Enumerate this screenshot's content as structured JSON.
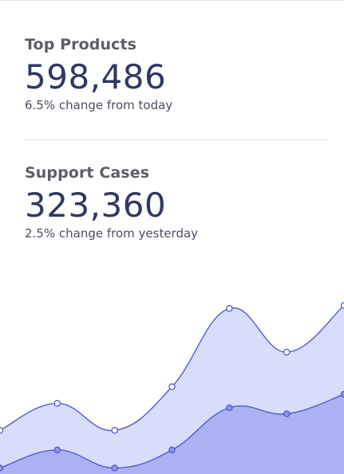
{
  "stats": [
    {
      "label": "Top Products",
      "value": "598,486",
      "change": "6.5% change from today"
    },
    {
      "label": "Support Cases",
      "value": "323,360",
      "change": "2.5% change from yesterday"
    }
  ],
  "colors": {
    "series_back_fill": "#d7ddfa",
    "series_front_fill": "#abb2f3",
    "line": "#4a52d6",
    "marker_fill_back": "#ffffff",
    "marker_fill_front": "#8c95ee",
    "value_text": "#2f3960"
  },
  "chart_data": {
    "type": "area",
    "x": [
      0,
      1,
      2,
      3,
      4,
      5,
      6
    ],
    "series": [
      {
        "values": [
          29,
          47,
          29,
          58,
          110,
          81,
          112
        ]
      },
      {
        "values": [
          4,
          16,
          4,
          16,
          44,
          40,
          53
        ]
      }
    ],
    "ylim": [
      0,
      135
    ],
    "grid": false,
    "axes_visible": false
  }
}
